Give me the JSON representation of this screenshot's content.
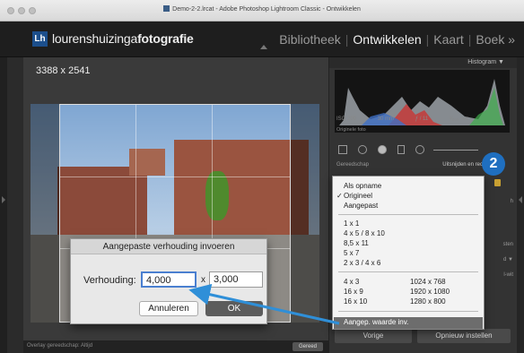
{
  "window": {
    "title": "Demo-2-2.lrcat - Adobe Photoshop Lightroom Classic - Ontwikkelen"
  },
  "header": {
    "logo_text": "Lh",
    "brand_regular": "lourenshuizinga",
    "brand_bold": "fotografie",
    "modules": [
      "Bibliotheek",
      "Ontwikkelen",
      "Kaart",
      "Boek »"
    ],
    "active_module": "Ontwikkelen"
  },
  "main": {
    "dimensions": "3388 x 2541",
    "overlay_label": "Overlay gereedschap: Altijd",
    "done_button": "Gereed"
  },
  "dialog": {
    "title": "Aangepaste verhouding invoeren",
    "ratio_label": "Verhouding:",
    "value1": "4,000",
    "times": "x",
    "value2": "3,000",
    "cancel_label": "Annuleren",
    "ok_label": "OK"
  },
  "right_panel": {
    "histogram_label": "Histogram ▼",
    "iso": "ISO 200",
    "focal": "30 mm",
    "aperture": "ƒ / 11",
    "shutter": "¹⁄₆₀₀ sec",
    "original_photo": "Originele foto",
    "tool_label": "Gereedschap",
    "crop_label": "Uitsnijden en rechttr.",
    "side_labels": [
      "h",
      "sten",
      "d ▼",
      "l-wit"
    ],
    "prev_button": "Vorige",
    "reset_button": "Opnieuw instellen"
  },
  "menu": {
    "group1": [
      "Als opname",
      "Origineel",
      "Aangepast"
    ],
    "checked": "Origineel",
    "group2": [
      "1 x 1",
      "4 x 5  /  8 x 10",
      "8,5 x 11",
      "5 x 7",
      "2 x 3  /  4 x 6"
    ],
    "group3_col1": [
      "4 x 3",
      "16 x 9",
      "16 x 10"
    ],
    "group3_col2": [
      "1024 x 768",
      "1920 x 1080",
      "1280 x 800"
    ],
    "custom": "Aangep. waarde inv."
  },
  "badge": "2",
  "colors": {
    "badge": "#1f6fc0",
    "arrow": "#2f8fd8",
    "logo": "#1c4f8c",
    "focus_ring": "#4a7fd0"
  }
}
